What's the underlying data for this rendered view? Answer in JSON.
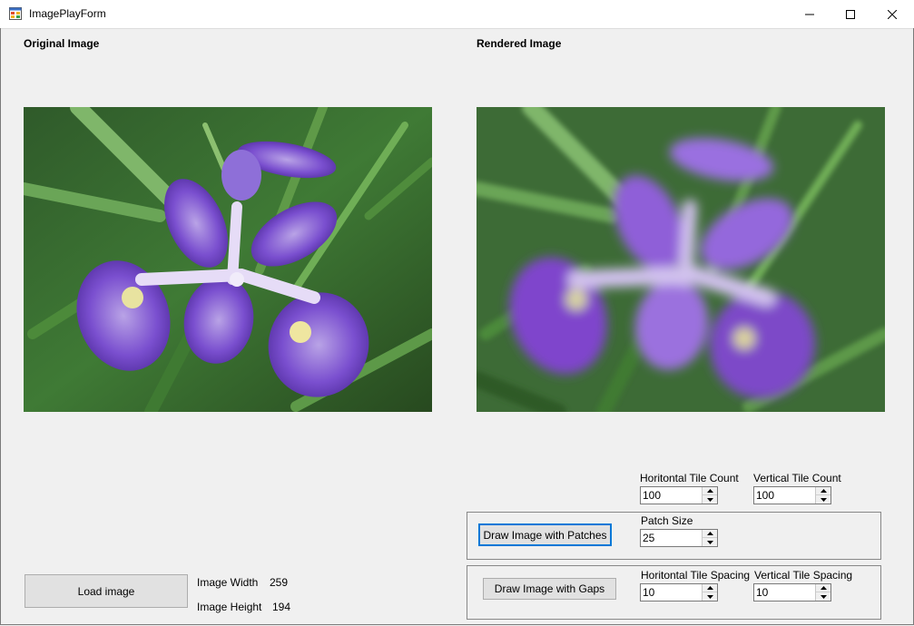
{
  "window": {
    "title": "ImagePlayForm",
    "app_icon": "form-app-icon",
    "controls": [
      "minimize-icon",
      "maximize-icon",
      "close-icon"
    ]
  },
  "panels": {
    "original_heading": "Original Image",
    "rendered_heading": "Rendered Image",
    "original_image": "iris flower photo (purple iris on green grass)",
    "rendered_image": "mosaic/patch-rendered iris flower"
  },
  "tile_count": {
    "horizontal_label": "Horitontal Tile Count",
    "horizontal_value": "100",
    "vertical_label": "Vertical Tile Count",
    "vertical_value": "100"
  },
  "patches": {
    "button_label": "Draw Image with Patches",
    "size_label": "Patch Size",
    "size_value": "25"
  },
  "gaps": {
    "button_label": "Draw Image with Gaps",
    "horizontal_spacing_label": "Horitontal Tile Spacing",
    "horizontal_spacing_value": "10",
    "vertical_spacing_label": "Vertical Tile Spacing",
    "vertical_spacing_value": "10"
  },
  "image_info": {
    "load_button_label": "Load image",
    "width_label": "Image Width",
    "width_value": "259",
    "height_label": "Image Height",
    "height_value": "194"
  },
  "colors": {
    "focus_border": "#0078d7",
    "button_bg": "#e1e1e1",
    "form_bg": "#f0f0f0"
  }
}
